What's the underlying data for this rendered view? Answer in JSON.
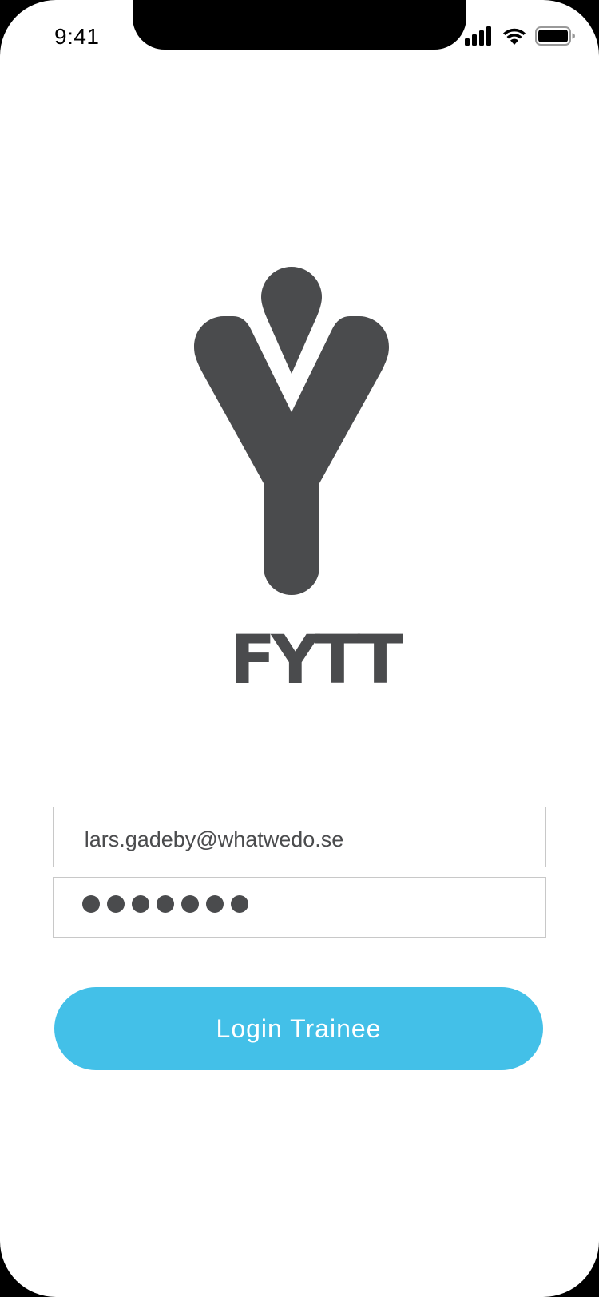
{
  "status_bar": {
    "time": "9:41",
    "icons": [
      "cellular-signal-icon",
      "wifi-icon",
      "battery-icon"
    ]
  },
  "brand": {
    "logo_icon": "fytt-y-logo-icon",
    "wordmark": "FYTT",
    "color": "#4a4b4d"
  },
  "login_form": {
    "email_value": "lars.gadeby@whatwedo.se",
    "password_mask_count": 7,
    "submit_label": "Login Trainee"
  },
  "colors": {
    "accent": "#43c0e8",
    "text": "#4a4b4d",
    "field_border": "#c8c8c8"
  }
}
